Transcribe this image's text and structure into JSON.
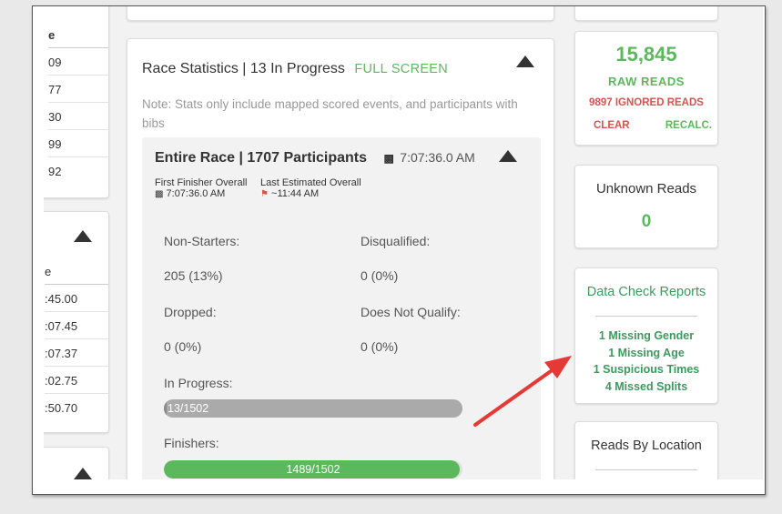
{
  "left_panel_top": {
    "header": "e",
    "rows": [
      "09",
      "77",
      "30",
      "99",
      "92"
    ]
  },
  "left_panel_mid": {
    "header": "e",
    "rows": [
      ":45.00",
      ":07.45",
      ":07.37",
      ":02.75",
      ":50.70"
    ]
  },
  "race_stats": {
    "title": "Race Statistics | 13 In Progress",
    "full_screen": "FULL SCREEN",
    "note": "Note: Stats only include mapped scored events, and participants with bibs",
    "entire_race": {
      "title": "Entire Race | 1707 Participants",
      "time": "7:07:36.0 AM",
      "first_finisher_label": "First Finisher Overall",
      "first_finisher_value": "7:07:36.0 AM",
      "last_estimated_label": "Last Estimated Overall",
      "last_estimated_value": "~11:44 AM",
      "non_starters_label": "Non-Starters:",
      "non_starters_value": "205 (13%)",
      "disqualified_label": "Disqualified:",
      "disqualified_value": "0 (0%)",
      "dropped_label": "Dropped:",
      "dropped_value": "0 (0%)",
      "dnq_label": "Does Not Qualify:",
      "dnq_value": "0 (0%)",
      "in_progress_label": "In Progress:",
      "in_progress_text": "13/1502",
      "in_progress_fraction": 0.0087,
      "finishers_label": "Finishers:",
      "finishers_text": "1489/1502",
      "finishers_fraction": 0.991
    }
  },
  "raw_reads": {
    "count": "15,845",
    "label": "RAW READS",
    "ignored": "9897 IGNORED READS",
    "clear": "CLEAR",
    "recalc": "RECALC."
  },
  "unknown_reads": {
    "title": "Unknown Reads",
    "value": "0"
  },
  "data_check": {
    "title": "Data Check Reports",
    "items": [
      "1 Missing Gender",
      "1 Missing Age",
      "1 Suspicious Times",
      "4 Missed Splits"
    ]
  },
  "reads_by_location": {
    "title": "Reads By Location"
  },
  "colors": {
    "green": "#5cb85c",
    "dark_green": "#3d9a5d",
    "red": "#d9534f",
    "bar_gray": "#aaaaaa",
    "arrow_red": "#e53935"
  }
}
